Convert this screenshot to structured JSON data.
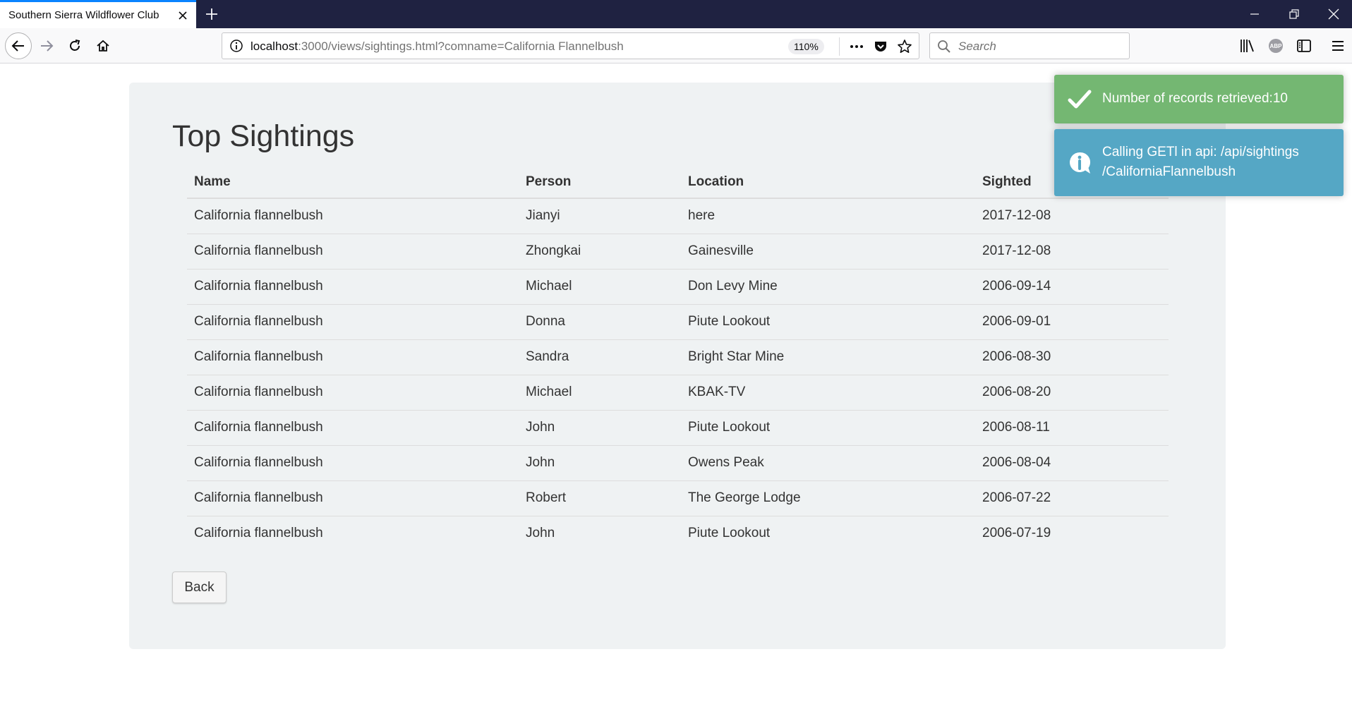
{
  "browser": {
    "tab_title": "Southern Sierra Wildflower Club",
    "url_host": "localhost",
    "url_rest": ":3000/views/sightings.html?comname=California Flannelbush",
    "zoom": "110%",
    "search_placeholder": "Search"
  },
  "page": {
    "title": "Top Sightings",
    "columns": [
      "Name",
      "Person",
      "Location",
      "Sighted"
    ],
    "rows": [
      [
        "California flannelbush",
        "Jianyi",
        "here",
        "2017-12-08"
      ],
      [
        "California flannelbush",
        "Zhongkai",
        "Gainesville",
        "2017-12-08"
      ],
      [
        "California flannelbush",
        "Michael",
        "Don Levy Mine",
        "2006-09-14"
      ],
      [
        "California flannelbush",
        "Donna",
        "Piute Lookout",
        "2006-09-01"
      ],
      [
        "California flannelbush",
        "Sandra",
        "Bright Star Mine",
        "2006-08-30"
      ],
      [
        "California flannelbush",
        "Michael",
        "KBAK-TV",
        "2006-08-20"
      ],
      [
        "California flannelbush",
        "John",
        "Piute Lookout",
        "2006-08-11"
      ],
      [
        "California flannelbush",
        "John",
        "Owens Peak",
        "2006-08-04"
      ],
      [
        "California flannelbush",
        "Robert",
        "The George Lodge",
        "2006-07-22"
      ],
      [
        "California flannelbush",
        "John",
        "Piute Lookout",
        "2006-07-19"
      ]
    ],
    "back_label": "Back"
  },
  "toasts": {
    "success": {
      "text": "Number of records retrieved:10",
      "color": "#74b772",
      "icon": "checkmark-icon"
    },
    "info": {
      "line1": "Calling GETl in api: /api/sightings",
      "line2": "/CaliforniaFlannelbush",
      "color": "#55a7c5",
      "icon": "info-icon"
    }
  },
  "icons": [
    "close-icon",
    "plus-icon",
    "minimize-icon",
    "restore-icon",
    "back-arrow-icon",
    "forward-arrow-icon",
    "reload-icon",
    "home-icon",
    "info-icon",
    "more-icon",
    "pocket-icon",
    "star-icon",
    "search-icon",
    "library-icon",
    "abp-icon",
    "sidebar-icon",
    "menu-icon"
  ]
}
